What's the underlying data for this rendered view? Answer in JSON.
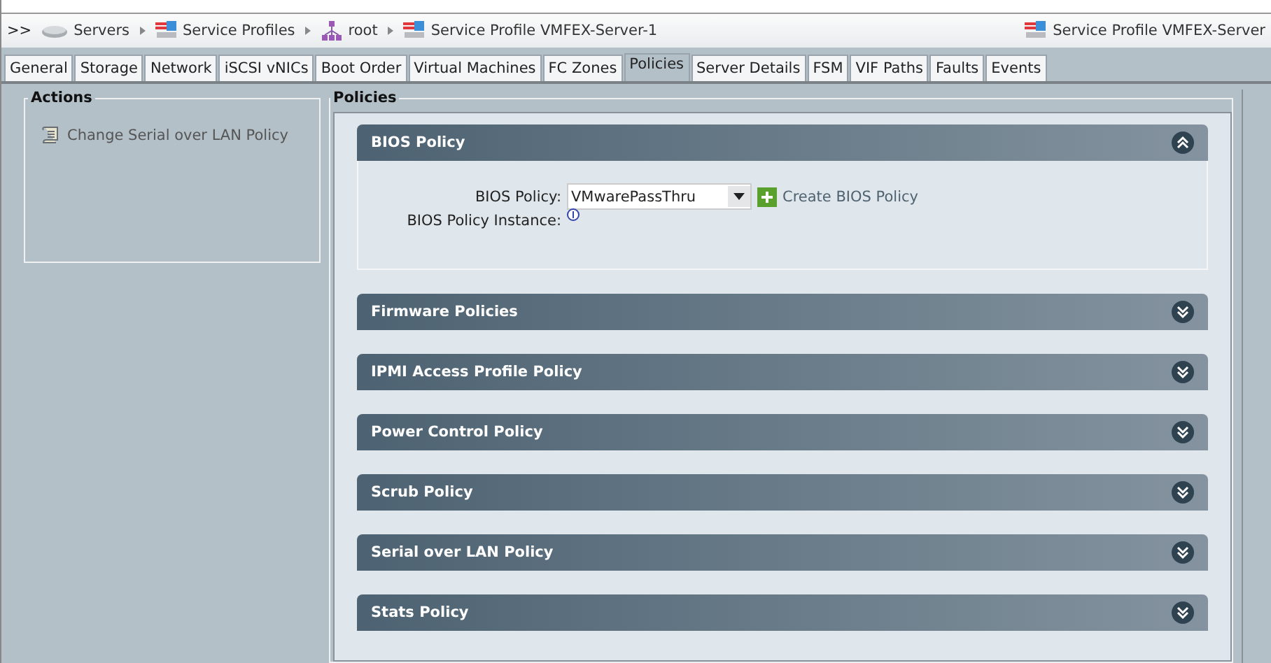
{
  "breadcrumb": {
    "lead": ">>",
    "items": [
      {
        "label": "Servers",
        "kind": "server"
      },
      {
        "label": "Service Profiles",
        "kind": "profile"
      },
      {
        "label": "root",
        "kind": "org"
      },
      {
        "label": "Service Profile VMFEX-Server-1",
        "kind": "profile"
      }
    ],
    "title": "Service Profile VMFEX-Server"
  },
  "tabs": [
    {
      "label": "General",
      "selected": false
    },
    {
      "label": "Storage",
      "selected": false
    },
    {
      "label": "Network",
      "selected": false
    },
    {
      "label": "iSCSI vNICs",
      "selected": false
    },
    {
      "label": "Boot Order",
      "selected": false
    },
    {
      "label": "Virtual Machines",
      "selected": false
    },
    {
      "label": "FC Zones",
      "selected": false
    },
    {
      "label": "Policies",
      "selected": true
    },
    {
      "label": "Server Details",
      "selected": false
    },
    {
      "label": "FSM",
      "selected": false
    },
    {
      "label": "VIF Paths",
      "selected": false
    },
    {
      "label": "Faults",
      "selected": false
    },
    {
      "label": "Events",
      "selected": false
    }
  ],
  "actions": {
    "title": "Actions",
    "items": [
      {
        "label": "Change Serial over LAN Policy"
      }
    ]
  },
  "policies": {
    "title": "Policies",
    "sections": [
      {
        "title": "BIOS Policy",
        "expanded": true,
        "fields": {
          "policy_label": "BIOS Policy:",
          "policy_value": "VMwarePassThru",
          "create_link": "Create BIOS Policy",
          "instance_label": "BIOS Policy Instance:"
        }
      },
      {
        "title": "Firmware Policies",
        "expanded": false
      },
      {
        "title": "IPMI Access Profile Policy",
        "expanded": false
      },
      {
        "title": "Power Control Policy",
        "expanded": false
      },
      {
        "title": "Scrub Policy",
        "expanded": false
      },
      {
        "title": "Serial over LAN Policy",
        "expanded": false
      },
      {
        "title": "Stats Policy",
        "expanded": false
      }
    ]
  }
}
